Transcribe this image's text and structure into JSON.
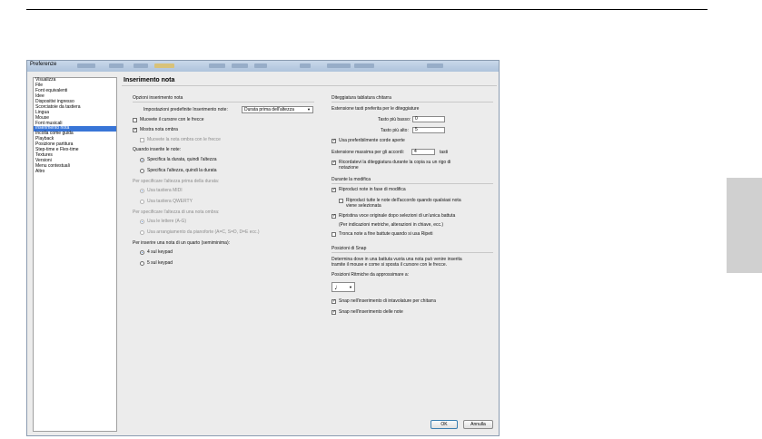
{
  "window": {
    "title": "Preferenze"
  },
  "nav": {
    "items": [
      "Visualizza",
      "File",
      "Font equivalenti",
      "Idee",
      "Dispositivi ingresso",
      "Scorciatoie da tastiera",
      "Lingua",
      "Mouse",
      "Font musicali",
      "Inserimento nota",
      "Incolla come guida",
      "Playback",
      "Posizione partitura",
      "Step-time e Flex-time",
      "Textures",
      "Versioni",
      "Menu contestuali",
      "Altro"
    ],
    "selected_index": 9
  },
  "page": {
    "heading": "Inserimento nota"
  },
  "left": {
    "section_title": "Opzioni inserimento nota",
    "default_label": "Impostazioni predefinite Inserimento note:",
    "default_value": "Durata prima dell'altezza",
    "move_cursor": "Muovete il cursore con le frecce",
    "show_shadow": "Mostra nota ombra",
    "move_shadow": "Muovete la nota ombra con le frecce",
    "when_entering": "Quando inserite le note:",
    "opt_duration_first": "Specifica la durata, quindi l'altezza",
    "opt_pitch_first": "Specifica l'altezza, quindi la durata",
    "pitch_before_duration": "Per specificare l'altezza prima della durata:",
    "use_midi": "Usa tastiera MIDI",
    "use_qwerty": "Usa tastiera QWERTY",
    "shadow_pitch": "Per specificare l'altezza di una nota ombra:",
    "use_letters": "Usa le lettere (A-G)",
    "use_piano": "Usa arrangiamento da pianoforte (A=C, S=D, D=E ecc.)",
    "quarter_note": "Per inserire una nota di un quarto (semiminima):",
    "keypad4": "4 sul keypad",
    "keypad5": "5 sul keypad"
  },
  "right": {
    "tab_title": "Diteggiatura tablatura chitarra",
    "range_title": "Estensione tasti preferita per le diteggiature",
    "lowest_label": "Tasto più basso:",
    "lowest_value": "0",
    "highest_label": "Tasto più alto:",
    "highest_value": "5",
    "prefer_open": "Usa preferibilmente corde aperte",
    "max_ext_label": "Estensione massima per gli accordi:",
    "max_ext_value": "4",
    "max_ext_unit": "tasti",
    "remember_line1": "Ricordatevi la diteggiatura durante la copia su un rigo di",
    "remember_line2": "notazione",
    "during_title": "Durante la modifica",
    "play_notes": "Riproduci note in fase di modifica",
    "play_chord_line1": "Riproduci tutte le note dell'accordo quando qualsiasi nota",
    "play_chord_line2": "viene selezionata",
    "restore_voice": "Ripristina voce originale dopo selezioni di un'unica battuta",
    "restore_note": "(Per indicazioni metriche, alterazioni in chiave, ecc.)",
    "truncate": "Tronca note a fine battute quando si usa Ripeti",
    "snap_title": "Posizioni di Snap",
    "snap_desc_line1": "Determina dove in una battuta vuota una nota può venire inserita",
    "snap_desc_line2": "tramite il mouse e come si sposta il cursore con le frecce.",
    "snap_rhythm_label": "Posizioni Ritmiche da approssimare a:",
    "snap_value": "♩",
    "snap_guitar": "Snap nell'inserimento di intavolature per chitarra",
    "snap_notes": "Snap nell'inserimento delle note"
  },
  "buttons": {
    "ok": "OK",
    "cancel": "Annulla"
  },
  "checks": {
    "move_cursor": false,
    "show_shadow": true,
    "move_shadow": false,
    "prefer_open": true,
    "remember": true,
    "play_notes": true,
    "play_chord": false,
    "restore_voice": true,
    "truncate": false,
    "snap_guitar": true,
    "snap_notes": true
  },
  "colors": {
    "selection": "#3875d7",
    "titlebar": "#b8cbe2",
    "window_bg": "#ececec"
  }
}
